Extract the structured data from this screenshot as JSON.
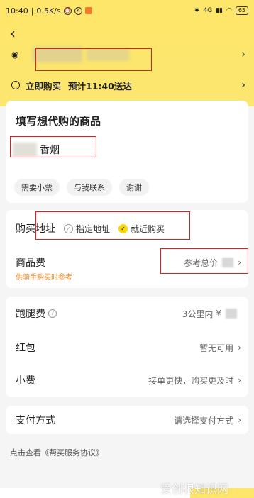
{
  "status": {
    "time": "10:40",
    "speed": "0.5K/s",
    "battery": "65",
    "signal": "4G"
  },
  "header": {
    "time_line": "立即购买",
    "delivery": "预计11:40送达"
  },
  "goods_card": {
    "title": "填写想代购的商品",
    "goods": "香烟",
    "chips": [
      "需要小票",
      "与我联系",
      "谢谢"
    ]
  },
  "purchase": {
    "address_label": "购买地址",
    "opt1": "指定地址",
    "opt2": "就近购买",
    "fee_label": "商品费",
    "fee_hint": "参考总价",
    "fee_note": "供骑手购买时参考"
  },
  "fees": {
    "run_label": "跑腿费",
    "run_value": "3公里内",
    "run_currency": "¥",
    "red_label": "红包",
    "red_value": "暂无可用",
    "tip_label": "小费",
    "tip_value": "接单更快，购买更及时"
  },
  "payment": {
    "label": "支付方式",
    "value": "请选择支付方式"
  },
  "agreement": "点击查看《帮买服务协议》",
  "watermark": "爱创根知识网"
}
